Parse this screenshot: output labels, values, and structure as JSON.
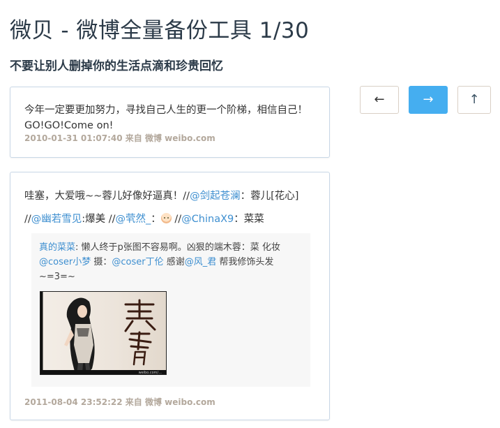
{
  "header": {
    "title": "微贝 - 微博全量备份工具 1/30",
    "subtitle": "不要让别人删掉你的生活点滴和珍贵回忆"
  },
  "nav": {
    "prev_label": "←",
    "next_label": "→",
    "top_label": "↑"
  },
  "colors": {
    "accent": "#45aef0",
    "link": "#3e8fd0",
    "meta": "#b3a89c",
    "title": "#2b3a48"
  },
  "posts": [
    {
      "text": "今年一定要更加努力，寻找自己人生的更一个阶梯，相信自己！GO!GO!Come on!",
      "meta": "2010-01-31 01:07:40 来自 微博 weibo.com"
    },
    {
      "text_parts": {
        "p1": "哇塞，大爱哦~~蓉儿好像好逼真！//",
        "m1": "@剑起苍澜",
        "p2": "：蓉儿[花心] //",
        "m2": "@幽若雪见",
        "p3": ":爆美 //",
        "m3": "@茕然_",
        "p4": "：",
        "p5": " //",
        "m4": "@ChinaX9",
        "p6": "：菜菜"
      },
      "emoji_icon": "baby-face-emoji",
      "repost": {
        "author": "真的菜菜",
        "t1": ": 懒人终于p张图不容易啊。凶狠的端木蓉：菜 化妆",
        "m1": "@coser小梦",
        "t2": " 摄：",
        "m2": "@coser丁伦",
        "t3": " 感谢",
        "m3": "@风_君",
        "t4": " 帮我修饰头发 ~=3=~",
        "image_caption": "weibo.com/..."
      },
      "meta": "2011-08-04 23:52:22 来自 微博 weibo.com"
    }
  ]
}
